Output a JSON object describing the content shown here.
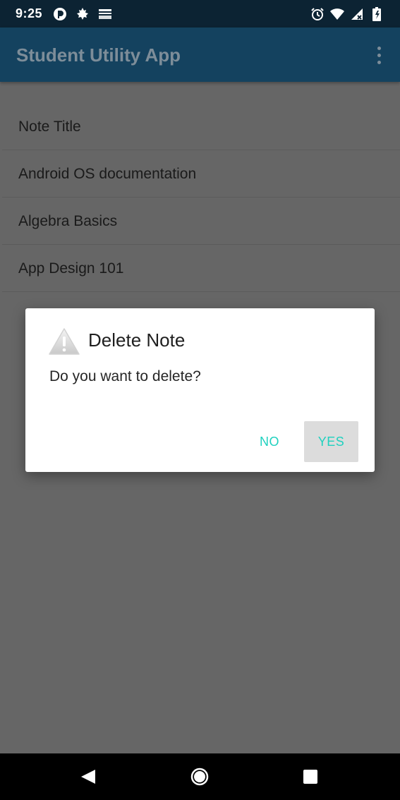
{
  "status_bar": {
    "time": "9:25",
    "left_icons": [
      "pocket-casts-icon",
      "maple-leaf-icon",
      "amazon-icon"
    ],
    "right_icons": [
      "alarm-icon",
      "wifi-icon",
      "signal-icon",
      "battery-icon"
    ]
  },
  "app_bar": {
    "title": "Student Utility App",
    "menu_icon": "overflow-menu-icon"
  },
  "notes": [
    {
      "title": "Note Title"
    },
    {
      "title": "Android OS documentation"
    },
    {
      "title": "Algebra Basics"
    },
    {
      "title": "App Design 101"
    }
  ],
  "dialog": {
    "icon": "warning-icon",
    "title": "Delete Note",
    "message": "Do you want to delete?",
    "no_label": "NO",
    "yes_label": "YES"
  },
  "nav_bar": {
    "icons": [
      "back-icon",
      "home-icon",
      "recents-icon"
    ]
  },
  "colors": {
    "accent": "#1fd1bf",
    "app_bar": "#14425f",
    "status_bar": "#0c2333",
    "scrim": "#666666"
  }
}
